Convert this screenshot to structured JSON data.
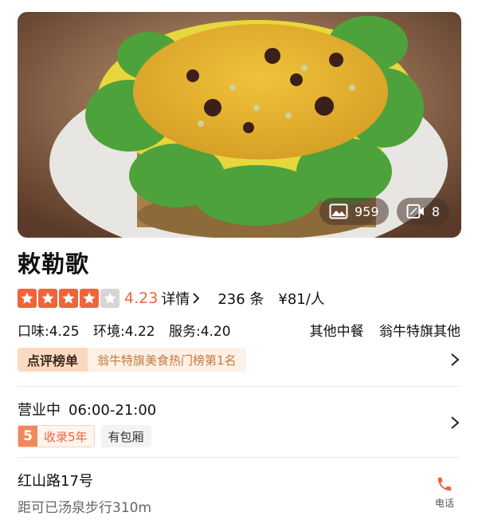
{
  "gallery": {
    "photo_count": "959",
    "video_count": "8"
  },
  "shop": {
    "name": "敕勒歌"
  },
  "rating": {
    "stars": 4.0,
    "max_stars": 5,
    "score": "4.23",
    "detail_label": "详情",
    "review_count": "236 条",
    "price": "¥81/人"
  },
  "subscores": {
    "taste": "口味:4.25",
    "environment": "环境:4.22",
    "service": "服务:4.20",
    "category": "其他中餐",
    "area": "翁牛特旗其他"
  },
  "ranking": {
    "badge": "点评榜单",
    "text": "翁牛特旗美食热门榜第1名"
  },
  "hours": {
    "status": "营业中",
    "time": "06:00-21:00"
  },
  "tags": {
    "years_number": "5",
    "years_label": "收录5年",
    "private_room": "有包厢"
  },
  "location": {
    "address": "红山路17号",
    "distance": "距可已汤泉步行310m"
  },
  "actions": {
    "phone_label": "电话"
  },
  "colors": {
    "accent": "#f0643a",
    "rank_bg": "#fdf0e6"
  }
}
